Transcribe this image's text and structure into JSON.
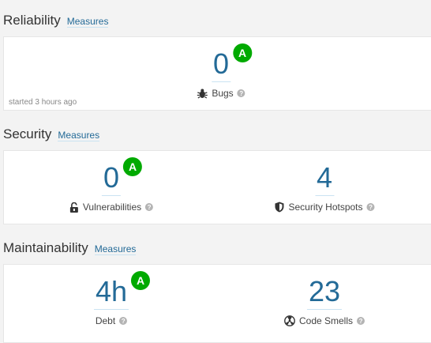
{
  "reliability": {
    "title": "Reliability",
    "measures_link": "Measures",
    "bugs": {
      "value": "0",
      "rating": "A",
      "label": "Bugs"
    },
    "started": "started 3 hours ago"
  },
  "security": {
    "title": "Security",
    "measures_link": "Measures",
    "vulnerabilities": {
      "value": "0",
      "rating": "A",
      "label": "Vulnerabilities"
    },
    "hotspots": {
      "value": "4",
      "label": "Security Hotspots"
    }
  },
  "maintainability": {
    "title": "Maintainability",
    "measures_link": "Measures",
    "debt": {
      "value": "4h",
      "rating": "A",
      "label": "Debt"
    },
    "code_smells": {
      "value": "23",
      "label": "Code Smells"
    }
  },
  "help_glyph": "?",
  "colors": {
    "rating_a": "#00aa00",
    "link": "#236a97"
  }
}
